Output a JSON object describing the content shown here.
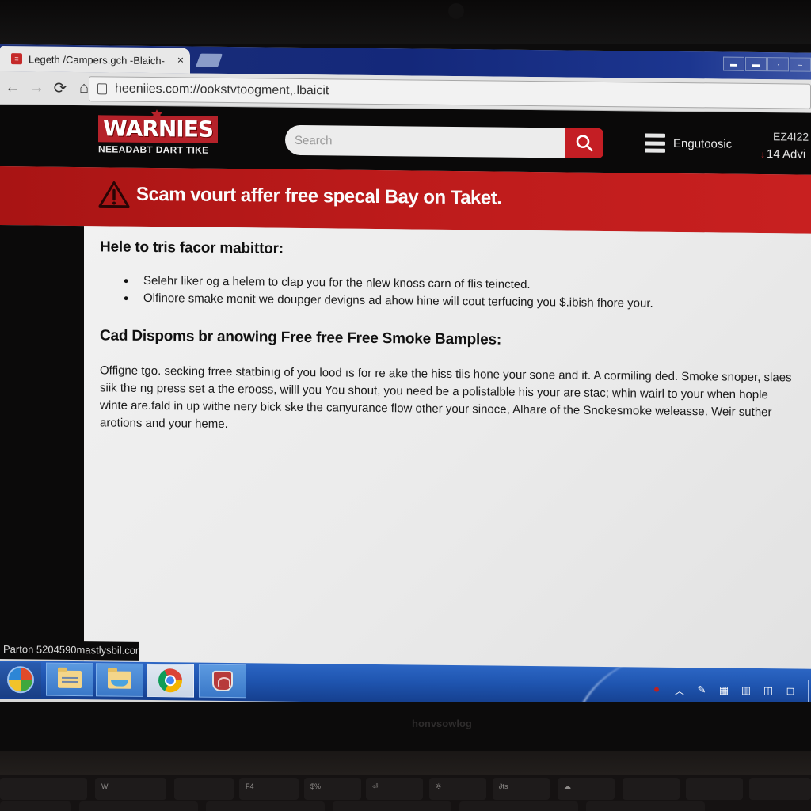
{
  "browser": {
    "tab_title": "Legeth /Campers.gch -Blaich-",
    "tab_close_label": "×",
    "url": "heeniies.com://ookstvtoogment,.lbaicit",
    "nav": {
      "back_icon": "←",
      "forward_icon": "→",
      "reload_icon": "⟳",
      "home_icon": "⌂"
    },
    "window_controls": [
      "minimize",
      "restore",
      "maximize",
      "close"
    ]
  },
  "site": {
    "logo_name": "WARNIES",
    "logo_tagline": "NEEADABT DART TIKE",
    "search_placeholder": "Search",
    "menu_label": "Engutoosic",
    "header_right_line1": "EZ4I22",
    "header_right_line2": "14 Advi",
    "header_right_arrow": "↓"
  },
  "alert": {
    "icon": "warning-triangle",
    "text": "Scam vourt affer free specal Bay on  Taket."
  },
  "content": {
    "heading1": "Hele to tris facor mabittor:",
    "bullets": [
      "Selehr liker og a helem to clap you for the nlew knoss carn of flis teincted.",
      "Olfinore smake monit we doupger devigns ad ahow hine will cout terfucing you $.ibish fhore your."
    ],
    "heading2": "Cad Dispoms br anowing Free free Free Smoke Bamples:",
    "paragraph": "Offigne tgo. secking frree statbinıg of you lood ıs for re ake the hiss tiis hone your sone and it. A cormiling ded. Smoke snoper, slaes siik the ng press set a the erooss, willl you You shout, you need be a polistalble his your are stac; whin wairl to your when hople winte are.fald in up withe nery bick ske the canyurance flow other your sinoce, Alhare of the Snokesmoke weleasse. Weir suther arotions and your heme."
  },
  "status_bar": {
    "url_text": "Parton 5204590mastlysbil.com"
  },
  "taskbar": {
    "items": [
      {
        "name": "start-orb"
      },
      {
        "name": "file-explorer"
      },
      {
        "name": "folder"
      },
      {
        "name": "chrome"
      },
      {
        "name": "shield-app"
      }
    ],
    "tray_icons": [
      "notification-dot",
      "chevron-up",
      "pen",
      "network",
      "volume",
      "book",
      "chat"
    ]
  },
  "hardware": {
    "bezel_brand": "honvsowlog",
    "key_labels": [
      "W",
      "F4",
      "$%",
      "⏎",
      "※",
      "∂ts",
      "☁"
    ]
  }
}
